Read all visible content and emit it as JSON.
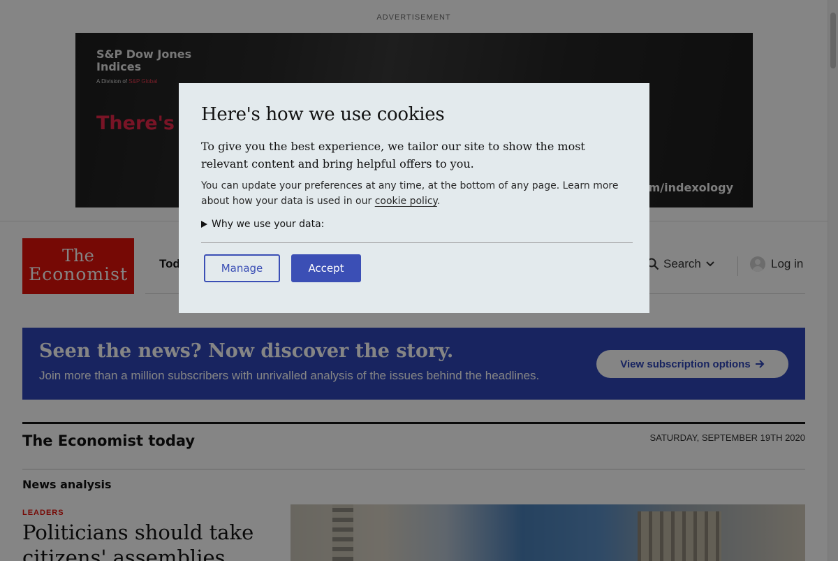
{
  "advertisement": {
    "label": "ADVERTISEMENT",
    "brand_line1": "S&P Dow Jones",
    "brand_line2": "Indices",
    "division_prefix": "A Division of",
    "division_name": "S&P Global",
    "headline_partial": "There's m",
    "url_partial": ".com/indexology"
  },
  "header": {
    "logo_line1": "The",
    "logo_line2": "Economist",
    "nav_today": "Tod",
    "search_label": "Search",
    "login_label": "Log in"
  },
  "promo": {
    "title": "Seen the news? Now discover the story.",
    "subtitle": "Join more than a million subscribers with unrivalled analysis of the issues behind the headlines.",
    "button_label": "View subscription options"
  },
  "today": {
    "title": "The Economist today",
    "date": "SATURDAY, SEPTEMBER 19TH 2020",
    "section": "News analysis",
    "kicker": "LEADERS",
    "headline": "Politicians should take citizens' assemblies"
  },
  "cookie_dialog": {
    "title": "Here's how we use cookies",
    "lead": "To give you the best experience, we tailor our site to show the most relevant content and bring helpful offers to you.",
    "body_before_link": "You can update your preferences at any time, at the bottom of any page. Learn more about how your data is used in our ",
    "link_text": "cookie policy",
    "body_after_link": ".",
    "why_label": "Why we use your data:",
    "manage_label": "Manage",
    "accept_label": "Accept"
  },
  "colors": {
    "brand_red": "#e3120b",
    "accent_blue": "#3b4fb5",
    "promo_blue": "#2e45b8",
    "dialog_bg": "#e3eaed"
  }
}
